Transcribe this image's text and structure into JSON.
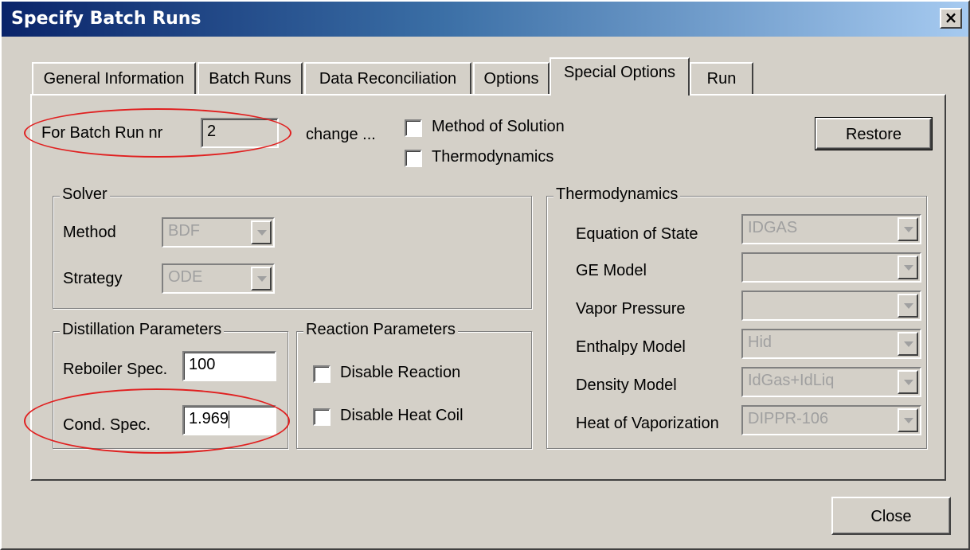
{
  "window": {
    "title": "Specify Batch Runs",
    "close_glyph": "×"
  },
  "tabs": [
    {
      "label": "General Information",
      "active": false
    },
    {
      "label": "Batch Runs",
      "active": false
    },
    {
      "label": "Data Reconciliation",
      "active": false
    },
    {
      "label": "Options",
      "active": false
    },
    {
      "label": "Special Options",
      "active": true
    },
    {
      "label": "Run",
      "active": false
    }
  ],
  "header_row": {
    "batch_run_label": "For Batch Run nr",
    "batch_run_value": "2",
    "change_label": "change ...",
    "method_of_solution_label": "Method of Solution",
    "method_of_solution_checked": false,
    "thermodynamics_label": "Thermodynamics",
    "thermodynamics_checked": false,
    "restore_label": "Restore"
  },
  "solver": {
    "title": "Solver",
    "method_label": "Method",
    "method_value": "BDF",
    "strategy_label": "Strategy",
    "strategy_value": "ODE"
  },
  "distillation": {
    "title": "Distillation Parameters",
    "reboiler_label": "Reboiler Spec.",
    "reboiler_value": "100",
    "cond_label": "Cond. Spec.",
    "cond_value": "1.969"
  },
  "reaction": {
    "title": "Reaction Parameters",
    "disable_reaction_label": "Disable Reaction",
    "disable_reaction_checked": false,
    "disable_heat_coil_label": "Disable Heat Coil",
    "disable_heat_coil_checked": false
  },
  "thermo": {
    "title": "Thermodynamics",
    "rows": [
      {
        "label": "Equation of State",
        "value": "IDGAS"
      },
      {
        "label": "GE Model",
        "value": ""
      },
      {
        "label": "Vapor Pressure",
        "value": ""
      },
      {
        "label": "Enthalpy Model",
        "value": "Hid"
      },
      {
        "label": "Density Model",
        "value": "IdGas+IdLiq"
      },
      {
        "label": "Heat of Vaporization",
        "value": "DIPPR-106"
      }
    ]
  },
  "footer": {
    "close_label": "Close"
  },
  "colors": {
    "annotation": "#e02020",
    "titlebar_start": "#0a246a",
    "dialog_face": "#d4d0c8"
  }
}
